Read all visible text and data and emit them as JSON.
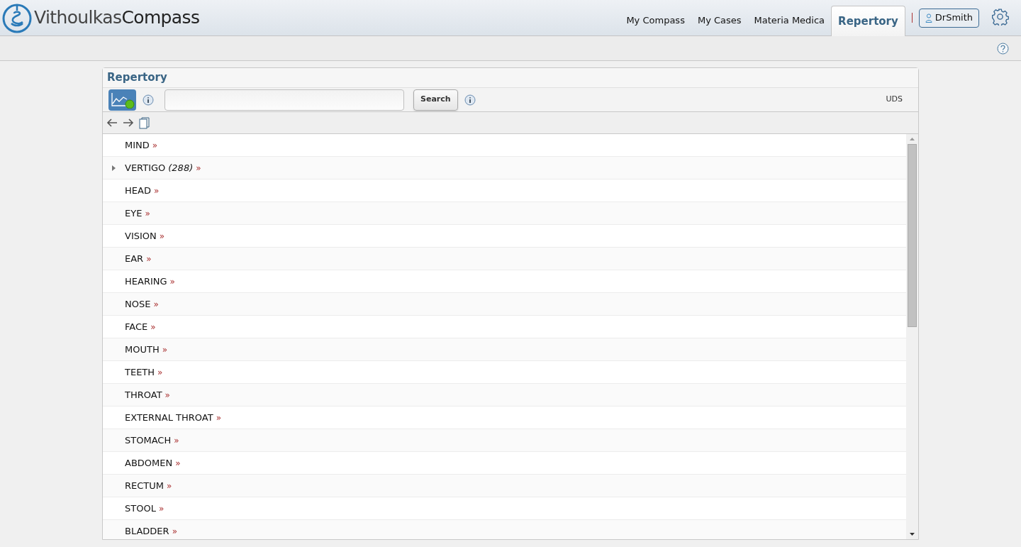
{
  "brand": {
    "first": "Vithoulkas",
    "second": "Compass"
  },
  "nav": [
    {
      "label": "My Compass",
      "selected": false
    },
    {
      "label": "My Cases",
      "selected": false
    },
    {
      "label": "Materia Medica",
      "selected": false
    },
    {
      "label": "Repertory",
      "selected": true
    }
  ],
  "user": {
    "label": "DrSmith"
  },
  "panel": {
    "title": "Repertory",
    "search_button": "Search",
    "source": "UDS"
  },
  "rows": [
    {
      "label": "MIND",
      "expandable": false,
      "marker": "»"
    },
    {
      "label": "VERTIGO",
      "count": "(288)",
      "expandable": true,
      "marker": "»"
    },
    {
      "label": "HEAD",
      "expandable": false,
      "marker": "»"
    },
    {
      "label": "EYE",
      "expandable": false,
      "marker": "»"
    },
    {
      "label": "VISION",
      "expandable": false,
      "marker": "»"
    },
    {
      "label": "EAR",
      "expandable": false,
      "marker": "»"
    },
    {
      "label": "HEARING",
      "expandable": false,
      "marker": "»"
    },
    {
      "label": "NOSE",
      "expandable": false,
      "marker": "»"
    },
    {
      "label": "FACE",
      "expandable": false,
      "marker": "»"
    },
    {
      "label": "MOUTH",
      "expandable": false,
      "marker": "»"
    },
    {
      "label": "TEETH",
      "expandable": false,
      "marker": "»"
    },
    {
      "label": "THROAT",
      "expandable": false,
      "marker": "»"
    },
    {
      "label": "EXTERNAL THROAT",
      "expandable": false,
      "marker": "»"
    },
    {
      "label": "STOMACH",
      "expandable": false,
      "marker": "»"
    },
    {
      "label": "ABDOMEN",
      "expandable": false,
      "marker": "»"
    },
    {
      "label": "RECTUM",
      "expandable": false,
      "marker": "»"
    },
    {
      "label": "STOOL",
      "expandable": false,
      "marker": "»"
    },
    {
      "label": "BLADDER",
      "expandable": false,
      "marker": "»"
    }
  ]
}
